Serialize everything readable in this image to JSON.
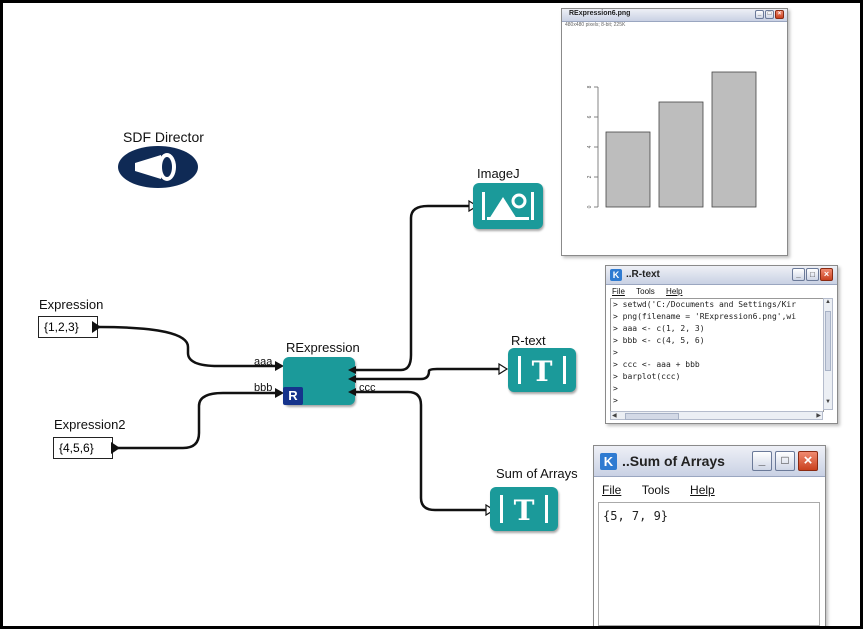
{
  "director": {
    "label": "SDF Director"
  },
  "expression1": {
    "label": "Expression",
    "value": "{1,2,3}"
  },
  "expression2": {
    "label": "Expression2",
    "value": "{4,5,6}"
  },
  "rexpression": {
    "label": "RExpression",
    "port_aaa": "aaa",
    "port_bbb": "bbb",
    "port_ccc": "ccc",
    "badge": "R"
  },
  "imagej": {
    "label": "ImageJ"
  },
  "rtext": {
    "label": "R-text"
  },
  "sum_actor": {
    "label": "Sum of Arrays"
  },
  "image_window": {
    "title": "RExpression6.png",
    "subtitle": "480x480 pixels; 8-bit; 225K",
    "chart_data": {
      "type": "bar",
      "categories": [
        "",
        "",
        ""
      ],
      "values": [
        5,
        7,
        9
      ],
      "ylim": [
        0,
        10
      ],
      "yticks": [
        "0",
        "2",
        "4",
        "6",
        "8"
      ],
      "title": "",
      "xlabel": "",
      "ylabel": ""
    }
  },
  "rtext_window": {
    "title": "..R-text",
    "menu": [
      "File",
      "Tools",
      "Help"
    ],
    "lines": [
      "> setwd('C:/Documents and Settings/Kir",
      "> png(filename = 'RExpression6.png',wi",
      "> aaa <- c(1, 2, 3)",
      "> bbb <- c(4, 5, 6)",
      ">",
      "> ccc <- aaa + bbb",
      "> barplot(ccc)",
      ">",
      ">"
    ]
  },
  "sum_window": {
    "title": "..Sum of Arrays",
    "menu": [
      "File",
      "Tools",
      "Help"
    ],
    "content": "{5, 7, 9}"
  },
  "colors": {
    "actor_teal": "#1b9a9a",
    "director_navy": "#0f2a55",
    "r_badge": "#15338c",
    "bar_gray": "#bdbdbd"
  }
}
